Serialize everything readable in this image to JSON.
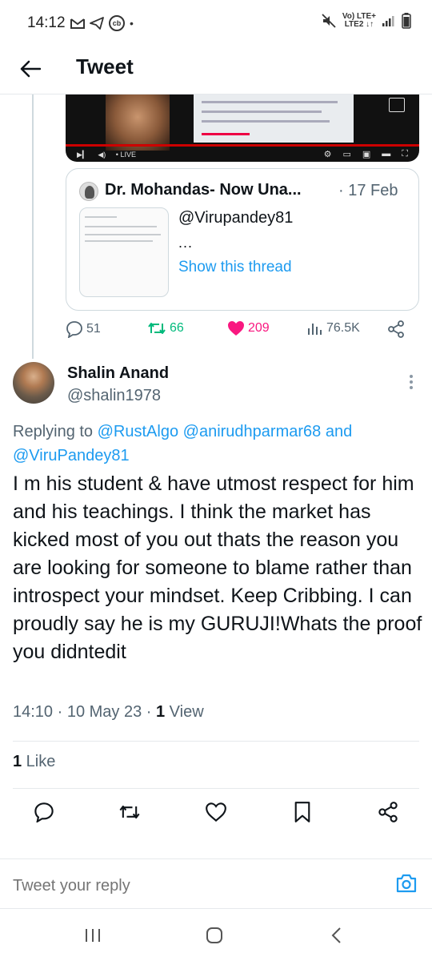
{
  "status_bar": {
    "time": "14:12",
    "left_icons": [
      "gmail-icon",
      "telegram-icon",
      "cb-app-icon"
    ],
    "cb_label": "cb",
    "net_line1": "Vo) LTE+",
    "net_line2": "LTE2 ↓↑",
    "right_icons": [
      "mute-icon",
      "signal-icon",
      "battery-icon"
    ]
  },
  "header": {
    "title": "Tweet"
  },
  "video": {
    "live_label": "LIVE"
  },
  "quoted_tweet": {
    "author": "Dr. Mohandas- Now Una...",
    "date": "· 17 Feb",
    "handle": "@Virupandey81",
    "ellipsis": "...",
    "show_thread": "Show this thread"
  },
  "prev_actions": {
    "replies": "51",
    "retweets": "66",
    "likes": "209",
    "views": "76.5K"
  },
  "tweet": {
    "author_name": "Shalin Anand",
    "author_handle": "@shalin1978",
    "replying_prefix": "Replying to ",
    "mention1": "@RustAlgo",
    "mention2": "@anirudhparmar68",
    "and": " and ",
    "mention3": "@ViruPandey81",
    "text": "I m his student & have utmost respect for him and his teachings. I think the market has kicked most of you out thats the reason you are looking for someone to blame rather than introspect your mindset. Keep Cribbing. I can proudly say he is my GURUJI!Whats the proof you didntedit",
    "time": "14:10 · 10 May 23 · ",
    "views_count": "1",
    "views_label": " View",
    "likes_count": "1",
    "likes_label": " Like"
  },
  "reply": {
    "placeholder": "Tweet your reply"
  },
  "colors": {
    "accent": "#1d9bf0",
    "retweet": "#00ba7c",
    "like": "#f91880",
    "muted": "#536471"
  }
}
